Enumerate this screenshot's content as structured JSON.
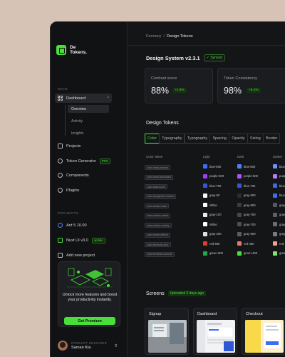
{
  "window": {
    "traffic_colors": [
      "#ec5f5b",
      "#f5be4f",
      "#5fc95a"
    ]
  },
  "app": {
    "logo_line1": "De",
    "logo_line2": "Tokens."
  },
  "sidebar": {
    "main_label": "MAIN",
    "dashboard": {
      "label": "Dashboard",
      "chevron": "^",
      "sub": [
        "Overview",
        "Activity",
        "Insights"
      ]
    },
    "items": [
      {
        "label": "Projects",
        "icon": "folder-icon"
      },
      {
        "label": "Token Generator",
        "icon": "token-icon",
        "badge": "PRO"
      },
      {
        "label": "Components",
        "icon": "components-icon"
      },
      {
        "label": "Plugins",
        "icon": "plug-icon"
      }
    ],
    "projects_label": "PROJECTS",
    "projects": [
      {
        "label": "Ant 5.10.00",
        "icon": "ant-icon"
      },
      {
        "label": "Nuxt UI v3.0",
        "icon": "nuxt-icon",
        "badge": "update"
      },
      {
        "label": "Add new project",
        "icon": "plus-icon"
      }
    ],
    "promo": {
      "text": "Unlock more features and boost your productivity instantly.",
      "button": "Get Premium"
    },
    "user": {
      "role": "PRODUCT DESIGNER",
      "name": "Saman Kia",
      "toggle": "⇕"
    }
  },
  "breadcrumb": {
    "root": "Fennecy",
    "sep": "/",
    "current": "Design Tokens"
  },
  "design_system": {
    "title": "Design System v2.3.1",
    "status": "Synced"
  },
  "stats": [
    {
      "label": "Contrast score",
      "value": "88%",
      "delta": "+2.9%"
    },
    {
      "label": "Token Consistency",
      "value": "98%",
      "delta": "+6.2%"
    }
  ],
  "tokens": {
    "title": "Design Tokens",
    "tabs": [
      "Color",
      "Typography",
      "Typography",
      "Spacing",
      "Opacity",
      "Sizing",
      "Border"
    ],
    "active_tab": 0,
    "columns": [
      "Color Token",
      "Light",
      "Dark",
      "Darker"
    ],
    "rows": [
      {
        "name": "color-brand-primary",
        "light": "blue-600",
        "dark": "blue-500",
        "darker": "blue-",
        "c": [
          "#3b6ef5",
          "#4f7ff7",
          "#6a93f8"
        ]
      },
      {
        "name": "color-brand-secondary",
        "light": "purple-600",
        "dark": "purple-500",
        "darker": "purp",
        "c": [
          "#9d3ff2",
          "#a855f7",
          "#b97af8"
        ]
      },
      {
        "name": "color-static-hover",
        "light": "blue-700",
        "dark": "blue-700",
        "darker": "blue-",
        "c": [
          "#2f58d8",
          "#2f58d8",
          "#3f6be0"
        ]
      },
      {
        "name": "color-background-canvas",
        "light": "gray-50",
        "dark": "gray-900",
        "darker": "blue-",
        "c": [
          "#f4f5f7",
          "#2a2c30",
          "#3b6ef5"
        ]
      },
      {
        "name": "color-surface-base",
        "light": "White",
        "dark": "gray-800",
        "darker": "gray-",
        "c": [
          "#ffffff",
          "#3a3c40",
          "#55585d"
        ]
      },
      {
        "name": "color-surface-raised",
        "light": "gray-100",
        "dark": "gray-750",
        "darker": "gray-",
        "c": [
          "#e9eaec",
          "#45484c",
          "#5d6066"
        ]
      },
      {
        "name": "color-surface-overlay",
        "light": "White",
        "dark": "gray-700",
        "darker": "gray-",
        "c": [
          "#ffffff",
          "#4c4f54",
          "#6a6d72"
        ]
      },
      {
        "name": "color-border-default",
        "light": "gray-200",
        "dark": "gray-600",
        "darker": "gray-",
        "c": [
          "#dfe0e2",
          "#5a5d62",
          "#787b80"
        ]
      },
      {
        "name": "color-feedback-error",
        "light": "red-600",
        "dark": "red-400",
        "darker": "red-",
        "c": [
          "#e23b3b",
          "#f87171",
          "#f99a9a"
        ]
      },
      {
        "name": "color-feedback-success",
        "light": "green-600",
        "dark": "green-400",
        "darker": "gree",
        "c": [
          "#22a845",
          "#4ade3a",
          "#7be66c"
        ]
      }
    ]
  },
  "screens": {
    "title": "Screens",
    "badge": "Uploaded 3 days ago",
    "cards": [
      {
        "label": "Signup"
      },
      {
        "label": "Dashboard"
      },
      {
        "label": "Checkout"
      }
    ]
  }
}
